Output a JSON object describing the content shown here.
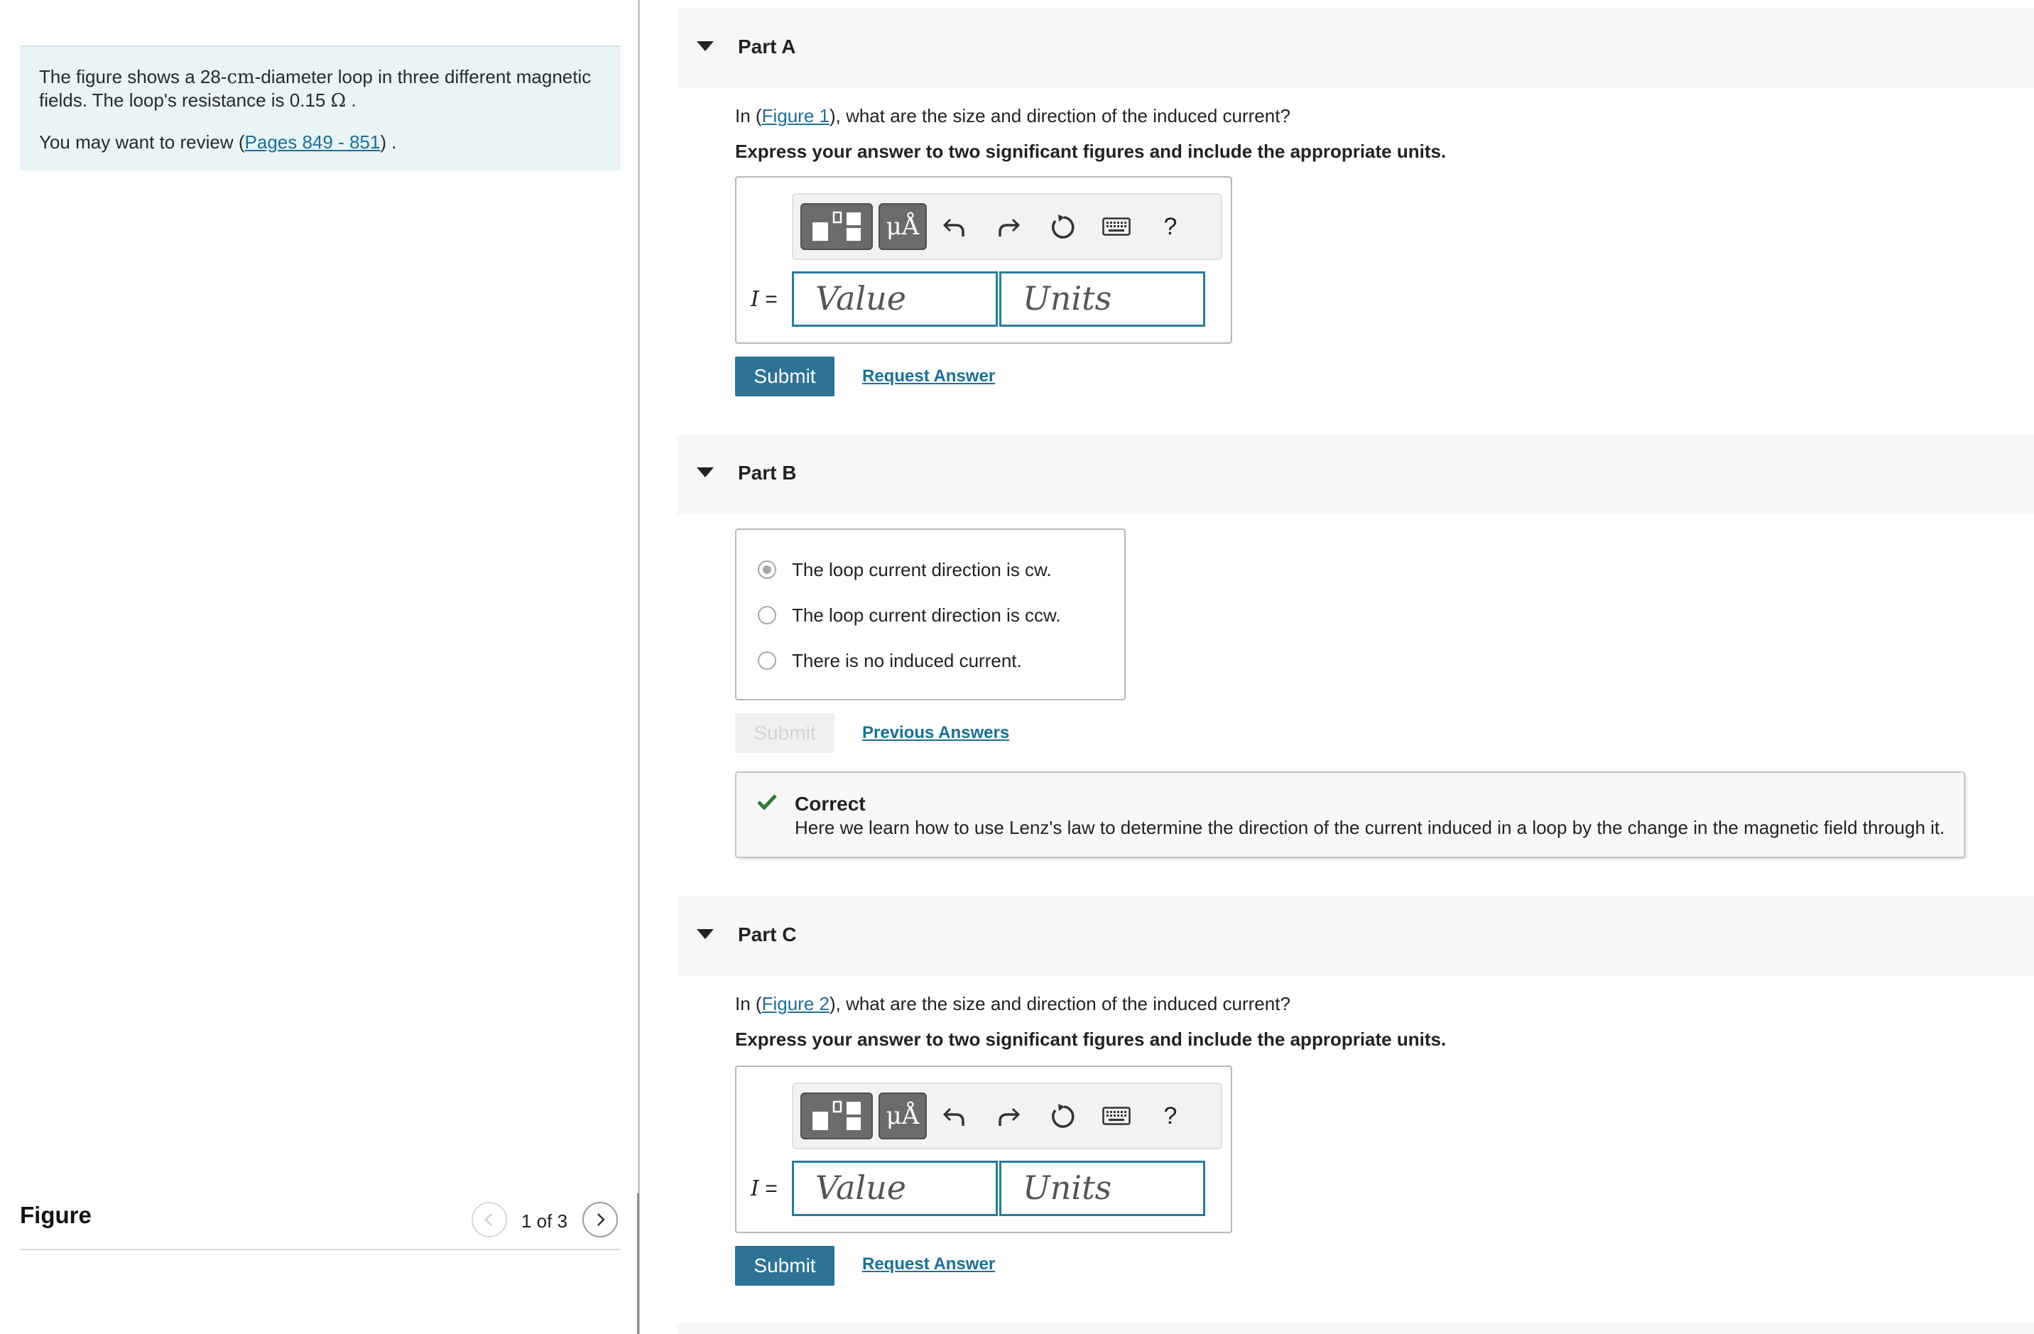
{
  "intro": {
    "line1_before": "The figure shows a 28-",
    "line1_unit": "cm",
    "line1_after": "-diameter loop in three different magnetic fields. The loop's resistance is 0.15 ",
    "line1_ohm": "Ω",
    "line1_end": " .",
    "review_before": "You may want to review (",
    "review_link": "Pages 849 - 851",
    "review_after": ") ."
  },
  "figure": {
    "title": "Figure",
    "counter": "1 of 3"
  },
  "partA": {
    "title": "Part A",
    "q_before": "In (",
    "q_link": "Figure 1",
    "q_after": "), what are the size and direction of the induced current?",
    "instruction": "Express your answer to two significant figures and include the appropriate units.",
    "var_symbol": "I",
    "var_eq": " =",
    "value_placeholder": "Value",
    "units_placeholder": "Units",
    "submit": "Submit",
    "request": "Request Answer"
  },
  "partB": {
    "title": "Part B",
    "options": [
      {
        "label": "The loop current direction is cw.",
        "selected": true
      },
      {
        "label": "The loop current direction is ccw.",
        "selected": false
      },
      {
        "label": "There is no induced current.",
        "selected": false
      }
    ],
    "submit": "Submit",
    "previous": "Previous Answers",
    "feedback_title": "Correct",
    "feedback_text": "Here we learn how to use Lenz's law to determine the direction of the current induced in a loop by the change in the magnetic field through it."
  },
  "partC": {
    "title": "Part C",
    "q_before": "In (",
    "q_link": "Figure 2",
    "q_after": "), what are the size and direction of the induced current?",
    "instruction": "Express your answer to two significant figures and include the appropriate units.",
    "var_symbol": "I",
    "var_eq": " =",
    "value_placeholder": "Value",
    "units_placeholder": "Units",
    "submit": "Submit",
    "request": "Request Answer"
  },
  "toolbar": {
    "units_label": "μÅ",
    "help_label": "?"
  },
  "icons": {
    "templates": "templates-icon",
    "undo": "undo-icon",
    "redo": "redo-icon",
    "reset": "reset-icon",
    "keyboard": "keyboard-icon",
    "check": "checkmark-icon",
    "caret": "caret-down-icon",
    "prev": "chevron-left-icon",
    "next": "chevron-right-icon"
  },
  "colors": {
    "link": "#1d6f96",
    "submit_bg": "#2c7396",
    "intro_bg": "#e8f4f6",
    "input_border": "#2a7aa0",
    "check": "#2e7d32"
  }
}
